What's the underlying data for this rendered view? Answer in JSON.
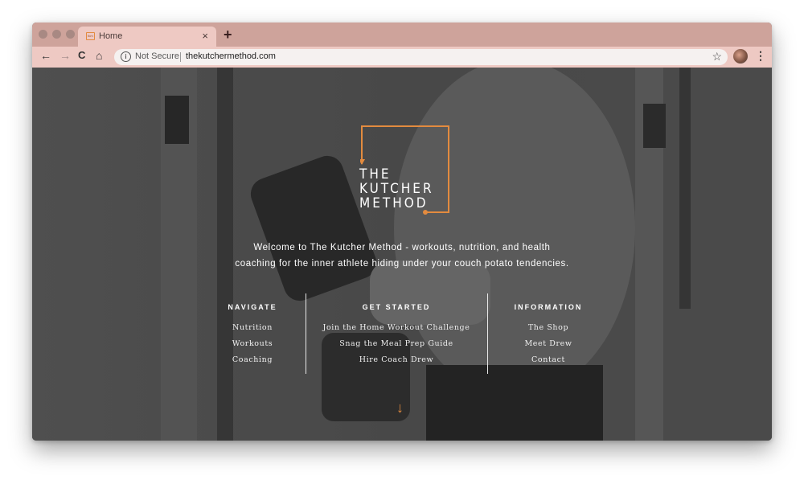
{
  "browser": {
    "tab": {
      "favicon": "tkm-favicon",
      "title": "Home",
      "close_icon": "×"
    },
    "new_tab_icon": "+",
    "nav": {
      "back": "←",
      "forward": "→",
      "reload": "C",
      "home": "⌂"
    },
    "omnibox": {
      "security_icon": "i",
      "security_label": "Not Secure",
      "url": "thekutchermethod.com"
    },
    "bookmark_icon": "☆",
    "menu_icon": "⋮"
  },
  "page": {
    "logo": {
      "line1": "THE",
      "line2": "KUTCHER",
      "line3": "METHOD"
    },
    "welcome": {
      "line1": "Welcome to The Kutcher Method - workouts, nutrition, and health",
      "line2": "coaching for the inner athlete hiding under your couch potato tendencies."
    },
    "columns": [
      {
        "heading": "NAVIGATE",
        "links": [
          "Nutrition",
          "Workouts",
          "Coaching"
        ]
      },
      {
        "heading": "GET STARTED",
        "links": [
          "Join the Home Workout Challenge",
          "Snag the Meal Prep Guide",
          "Hire Coach Drew"
        ]
      },
      {
        "heading": "INFORMATION",
        "links": [
          "The Shop",
          "Meet Drew",
          "Contact"
        ]
      }
    ],
    "scroll_icon": "↓",
    "accent_color": "#e38b3f"
  }
}
